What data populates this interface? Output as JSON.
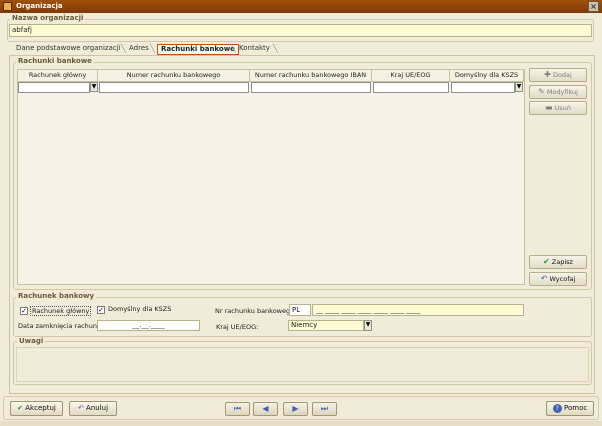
{
  "window": {
    "title": "Organizacja",
    "close_glyph": "×"
  },
  "org_name": {
    "label": "Nazwa organizacji",
    "value": "abfafj"
  },
  "tabs": [
    {
      "label": "Dane podstawowe organizacji"
    },
    {
      "label": "Adres"
    },
    {
      "label": "Rachunki bankowe"
    },
    {
      "label": "Kontakty"
    }
  ],
  "bank_accounts_group": {
    "title": "Rachunki bankowe"
  },
  "table": {
    "columns": [
      "Rachunek główny",
      "Numer rachunku bankowego",
      "Numer rachunku bankowego IBAN",
      "Kraj UE/EOG",
      "Domyślny dla KSZS"
    ],
    "dropdown_glyph": "▼"
  },
  "side_buttons": {
    "add": {
      "icon": "plus-icon",
      "glyph": "✚",
      "label": "Dodaj"
    },
    "modify": {
      "icon": "pencil-icon",
      "glyph": "✎",
      "label": "Modyfikuj"
    },
    "delete": {
      "icon": "minus-icon",
      "glyph": "▬",
      "label": "Usuń"
    },
    "save": {
      "icon": "check-icon",
      "glyph": "✔",
      "label": "Zapisz"
    },
    "revert": {
      "icon": "undo-icon",
      "glyph": "↶",
      "label": "Wycofaj"
    }
  },
  "account_form": {
    "title": "Rachunek bankowy",
    "main_account": {
      "label": "Rachunek główny",
      "checked": true,
      "glyph": "✓"
    },
    "default_kszs": {
      "label": "Domyślny dla KSZS",
      "checked": true,
      "glyph": "✓"
    },
    "account_number": {
      "label": "Nr rachunku bankowego:",
      "country_prefix": "PL",
      "mask": "__ ____ ____ ____ ____ ____ ____"
    },
    "close_date": {
      "label": "Data zamknięcia rachunku:",
      "mask": "__.__.____"
    },
    "country": {
      "label": "Kraj UE/EOG:",
      "value": "Niemcy",
      "dropdown_glyph": "▼"
    }
  },
  "notes": {
    "title": "Uwagi"
  },
  "footer": {
    "accept": {
      "icon": "check-icon",
      "glyph": "✔",
      "label": "Akceptuj"
    },
    "cancel": {
      "icon": "undo-icon",
      "glyph": "↶",
      "label": "Anuluj"
    },
    "nav": {
      "first": "⏮",
      "prev": "◀",
      "next": "▶",
      "last": "⏭"
    },
    "help": {
      "icon": "help-icon",
      "glyph": "?",
      "label": "Pomoc"
    }
  },
  "colors": {
    "titlebar": "#8e4309",
    "background": "#f1ecd9",
    "input_yellow": "#fffbd5",
    "accent_green": "#2e9a2e",
    "nav_blue": "#3f62b5"
  }
}
